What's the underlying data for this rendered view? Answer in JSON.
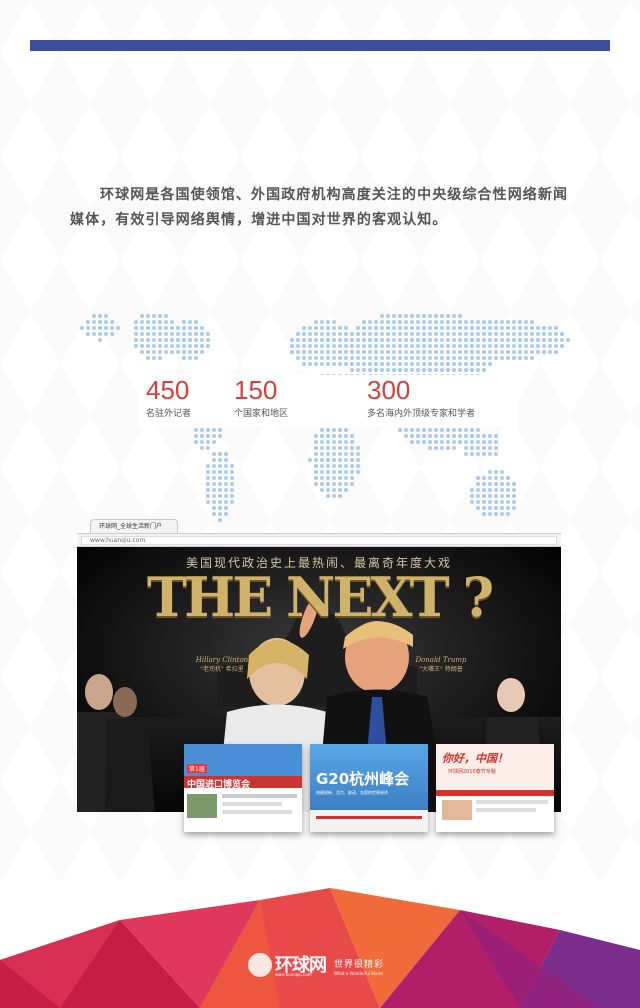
{
  "header": {
    "accent_color": "#3a4f9c"
  },
  "intro": {
    "text": "环球网是各国使领馆、外国政府机构高度关注的中央级综合性网络新闻媒体，有效引导网络舆情，增进中国对世界的客观认知。"
  },
  "stats": [
    {
      "value": "450",
      "label": "名驻外记者"
    },
    {
      "value": "150",
      "label": "个国家和地区"
    },
    {
      "value": "300",
      "label": "多名海内外顶级专家和学者"
    }
  ],
  "browser": {
    "tab_title": "环球网_全球生活新门户",
    "url": "www.huanqiu.com",
    "banner_line": "美国现代政治史上最热闹、最离奇年度大戏",
    "headline": "THE NEXT ?",
    "candidate_left": {
      "name": "Hillary Clinton",
      "nickname": "\"老司机\" 希拉里"
    },
    "candidate_right": {
      "name": "Donald Trump",
      "nickname": "\"大嘴王\" 特朗普"
    }
  },
  "thumbnails": [
    {
      "title": "中国进口博览会",
      "subtitle": "第1届"
    },
    {
      "title": "G20杭州峰会",
      "subtitle": "构建创新、活力、联动、包容的世界经济"
    },
    {
      "title": "你好，中国！",
      "subtitle": "环球网2016春节专题"
    }
  ],
  "footer": {
    "logo_text": "环球网",
    "logo_url": "www.huanqiu.com",
    "slogan": "世界很精彩",
    "slogan_en": "What a Wonderful World"
  }
}
